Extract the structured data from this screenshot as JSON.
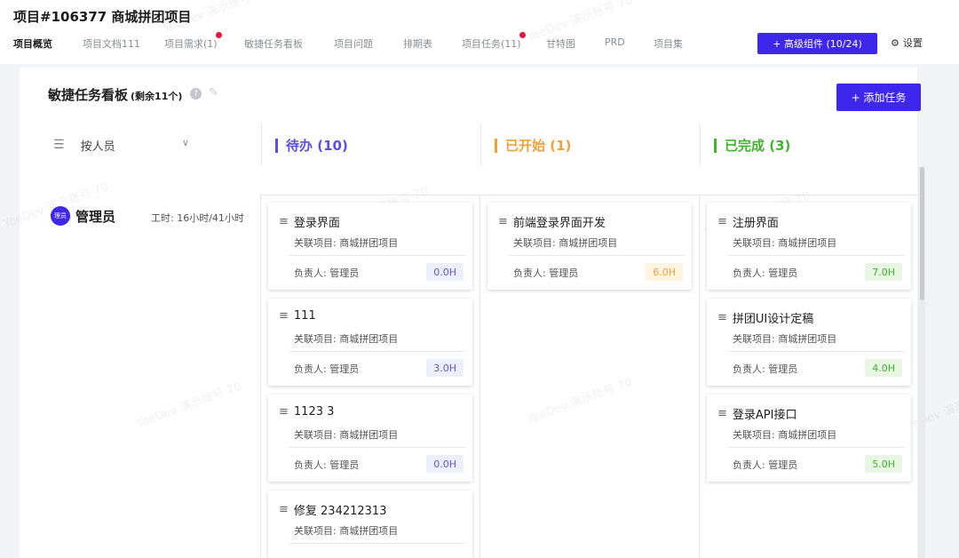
{
  "project_title": "项目#106377 商城拼团项目",
  "tabs": [
    {
      "label": "项目概览",
      "active": true,
      "dot": false
    },
    {
      "label": "项目文档111",
      "active": false,
      "dot": false
    },
    {
      "label": "项目需求(1)",
      "active": false,
      "dot": true
    },
    {
      "label": "敏捷任务看板",
      "active": false,
      "dot": false
    },
    {
      "label": "项目问题",
      "active": false,
      "dot": false
    },
    {
      "label": "排期表",
      "active": false,
      "dot": false
    },
    {
      "label": "项目任务(11)",
      "active": false,
      "dot": true
    },
    {
      "label": "甘特图",
      "active": false,
      "dot": false
    },
    {
      "label": "PRD",
      "active": false,
      "dot": false
    },
    {
      "label": "项目集",
      "active": false,
      "dot": false
    }
  ],
  "advanced_button": "+ 高级组件 (10/24)",
  "settings_label": "设置",
  "board": {
    "title": "敏捷任务看板",
    "remaining": "(剩余11个)",
    "add_button": "+ 添加任务",
    "group_by": "按人员"
  },
  "columns": [
    {
      "label": "待办 (10)",
      "color": "#5a4fe8"
    },
    {
      "label": "已开始 (1)",
      "color": "#f0a23a"
    },
    {
      "label": "已完成 (3)",
      "color": "#3fb52c"
    }
  ],
  "user": {
    "avatar_text": "理员",
    "name": "管理员",
    "work_hours": "工时: 16小时/41小时"
  },
  "cards": {
    "todo": [
      {
        "title": "登录界面",
        "project": "关联项目: 商城拼团项目",
        "owner": "负责人: 管理员",
        "hours": "0.0H"
      },
      {
        "title": "111",
        "project": "关联项目: 商城拼团项目",
        "owner": "负责人: 管理员",
        "hours": "3.0H"
      },
      {
        "title": "1123 3",
        "project": "关联项目: 商城拼团项目",
        "owner": "负责人: 管理员",
        "hours": "0.0H"
      },
      {
        "title": "修复 234212313",
        "project": "关联项目: 商城拼团项目",
        "owner": "",
        "hours": ""
      }
    ],
    "started": [
      {
        "title": "前端登录界面开发",
        "project": "关联项目: 商城拼团项目",
        "owner": "负责人: 管理员",
        "hours": "6.0H"
      }
    ],
    "done": [
      {
        "title": "注册界面",
        "project": "关联项目: 商城拼团项目",
        "owner": "负责人: 管理员",
        "hours": "7.0H"
      },
      {
        "title": "拼团UI设计定稿",
        "project": "关联项目: 商城拼团项目",
        "owner": "负责人: 管理员",
        "hours": "4.0H"
      },
      {
        "title": "登录API接口",
        "project": "关联项目: 商城拼团项目",
        "owner": "负责人: 管理员",
        "hours": "5.0H"
      }
    ]
  },
  "watermark": "YeeDev 演示账号 70"
}
